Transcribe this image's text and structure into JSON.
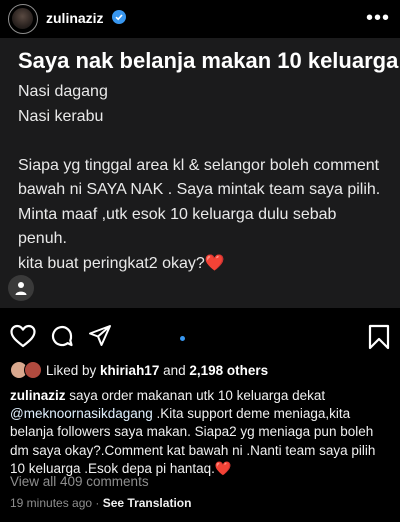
{
  "header": {
    "username": "zulinaziz",
    "more_label": "•••"
  },
  "post": {
    "title": "Saya nak belanja makan 10 keluarga",
    "lines": [
      "Nasi dagang",
      "Nasi kerabu",
      "",
      "Siapa yg tinggal area kl & selangor boleh comment",
      "bawah ni  SAYA NAK . Saya mintak team saya pilih.",
      "Minta maaf ,utk esok 10 keluarga dulu sebab",
      "penuh.",
      "kita buat peringkat2 okay?"
    ],
    "heart_emoji": "❤️"
  },
  "likes": {
    "prefix": "Liked by ",
    "user": "khiriah17",
    "middle": " and ",
    "count": "2,198 others"
  },
  "caption": {
    "username": "zulinaziz",
    "text_1": " saya order makanan utk 10 keluarga dekat ",
    "mention": "@meknoornasikdagang",
    "text_2": " .Kita support deme meniaga,kita belanja followers saya makan. Siapa2 yg meniaga pun boleh dm saya okay?.Comment kat bawah ni .Nanti team saya pilih 10 keluarga .Esok depa pi hantaq.",
    "emoji": "❤️"
  },
  "comments": {
    "view_all": "View all 409 comments"
  },
  "meta": {
    "time": "19 minutes ago",
    "separator": " · ",
    "translation": "See Translation"
  },
  "colors": {
    "background": "#000000",
    "post_background": "#1b1b1c",
    "verified": "#3897f0",
    "secondary_text": "#8e8e8e"
  }
}
